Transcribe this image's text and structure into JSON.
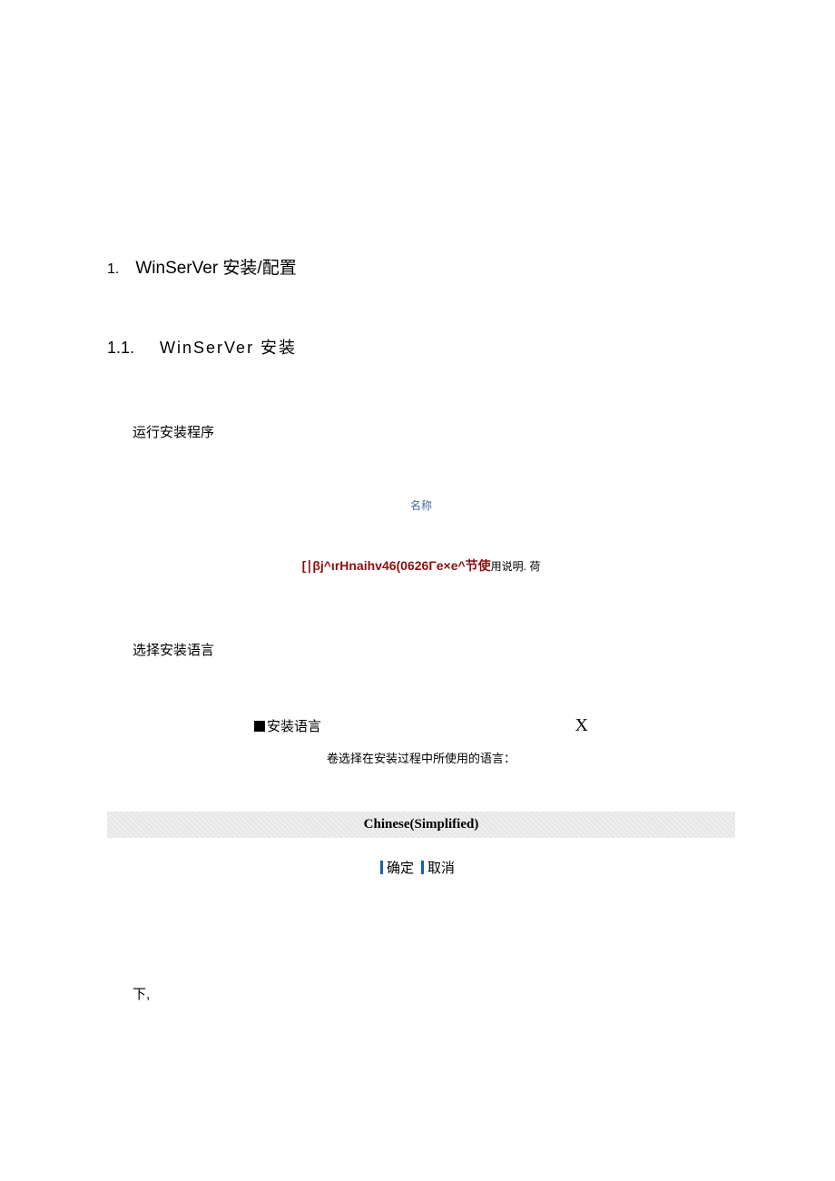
{
  "heading1": {
    "num": "1.",
    "text": "WinSerVer 安装/配置"
  },
  "heading2": {
    "num": "1.1.",
    "text": "WinSerVer 安装"
  },
  "para1": "运行安装程序",
  "nameLabel": "名称",
  "garbled": {
    "red": "[∣βj^ιrHnaihv46(0626Γe×e^节使",
    "tail": "用说明. 荷"
  },
  "para2": "选择安装语言",
  "dialog": {
    "title": "安装语言",
    "close": "X",
    "subtitle": "卷选择在安装过程中所使用的语言：",
    "language": "Chinese(Simplified)",
    "ok": "确定",
    "cancel": "取消"
  },
  "para3": "下,"
}
